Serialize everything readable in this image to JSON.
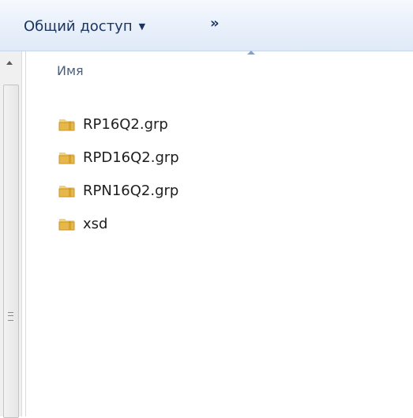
{
  "toolbar": {
    "share_label": "Общий доступ",
    "more_label": "»"
  },
  "list": {
    "column_name": "Имя",
    "items": [
      {
        "name": "RP16Q2.grp",
        "icon": "folder-icon"
      },
      {
        "name": "RPD16Q2.grp",
        "icon": "folder-icon"
      },
      {
        "name": "RPN16Q2.grp",
        "icon": "folder-icon"
      },
      {
        "name": "xsd",
        "icon": "folder-icon"
      }
    ]
  },
  "colors": {
    "toolbar_top": "#f6f9fd",
    "toolbar_bottom": "#dfe9f7",
    "toolbar_text": "#1b3560",
    "header_text": "#4c607a"
  }
}
